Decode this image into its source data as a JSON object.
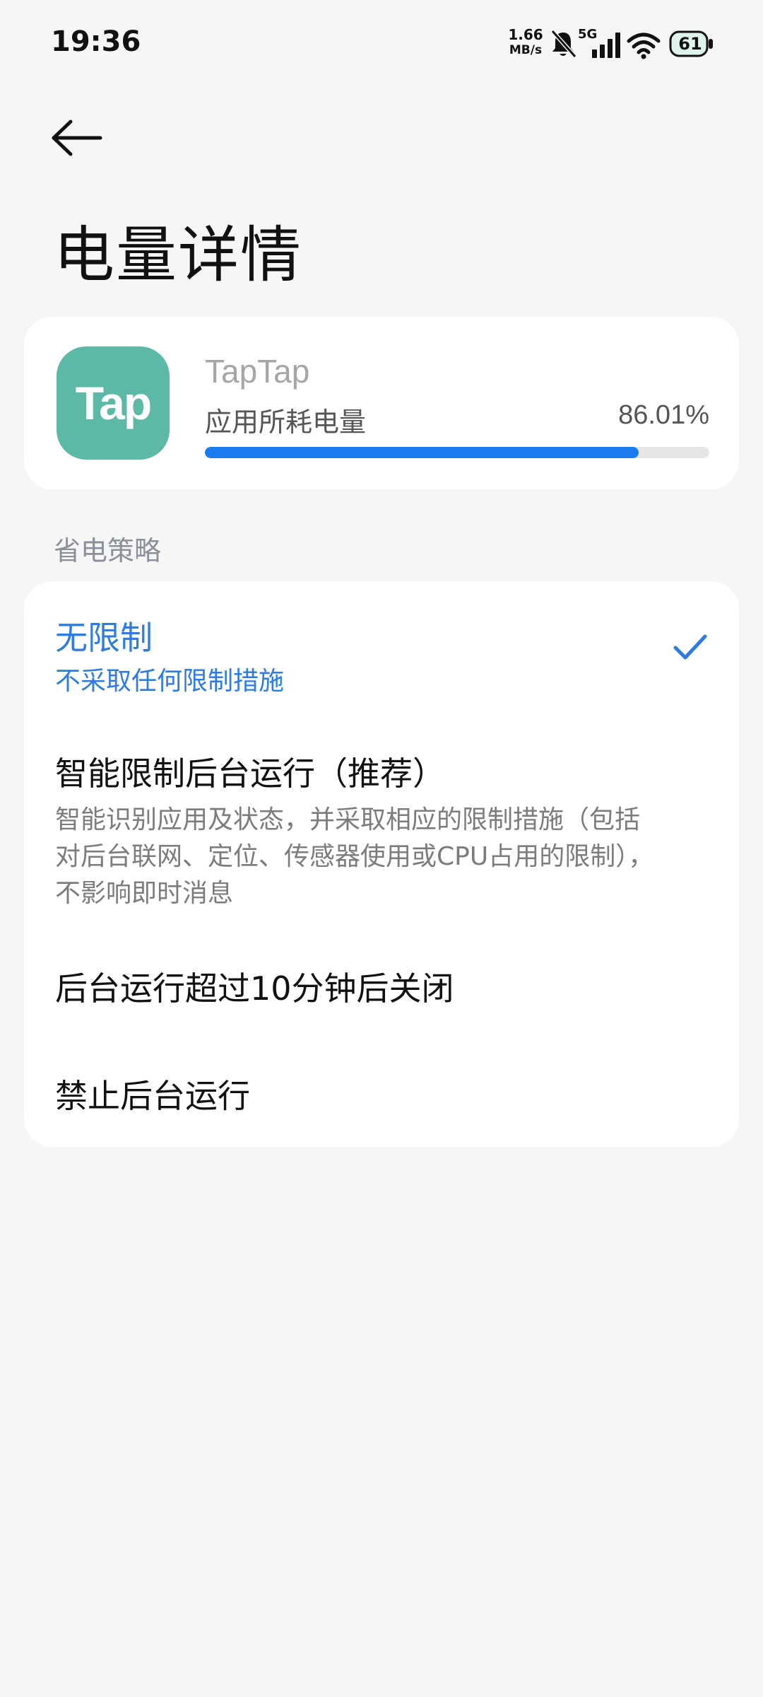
{
  "status_bar": {
    "time": "19:36",
    "net_speed_value": "1.66",
    "net_speed_unit": "MB/s",
    "network_type": "5G",
    "battery_level": "61",
    "icons": [
      "mute-icon",
      "signal-icon",
      "wifi-icon",
      "battery-icon"
    ]
  },
  "header": {
    "back_icon": "arrow-left-icon",
    "title": "电量详情"
  },
  "app": {
    "name": "TapTap",
    "icon_text": "Tap",
    "icon_color": "#5cb8a7",
    "usage_label": "应用所耗电量",
    "usage_value": "86.01%",
    "usage_fraction": 0.8601,
    "accent_color": "#1a7cf0"
  },
  "strategy": {
    "section_label": "省电策略",
    "options": [
      {
        "title": "无限制",
        "description": "不采取任何限制措施",
        "selected": true
      },
      {
        "title": "智能限制后台运行（推荐）",
        "description": "智能识别应用及状态，并采取相应的限制措施（包括对后台联网、定位、传感器使用或CPU占用的限制），不影响即时消息",
        "selected": false
      },
      {
        "title": "后台运行超过10分钟后关闭",
        "description": "",
        "selected": false
      },
      {
        "title": "禁止后台运行",
        "description": "",
        "selected": false
      }
    ],
    "selected_color": "#2e7ce0"
  }
}
